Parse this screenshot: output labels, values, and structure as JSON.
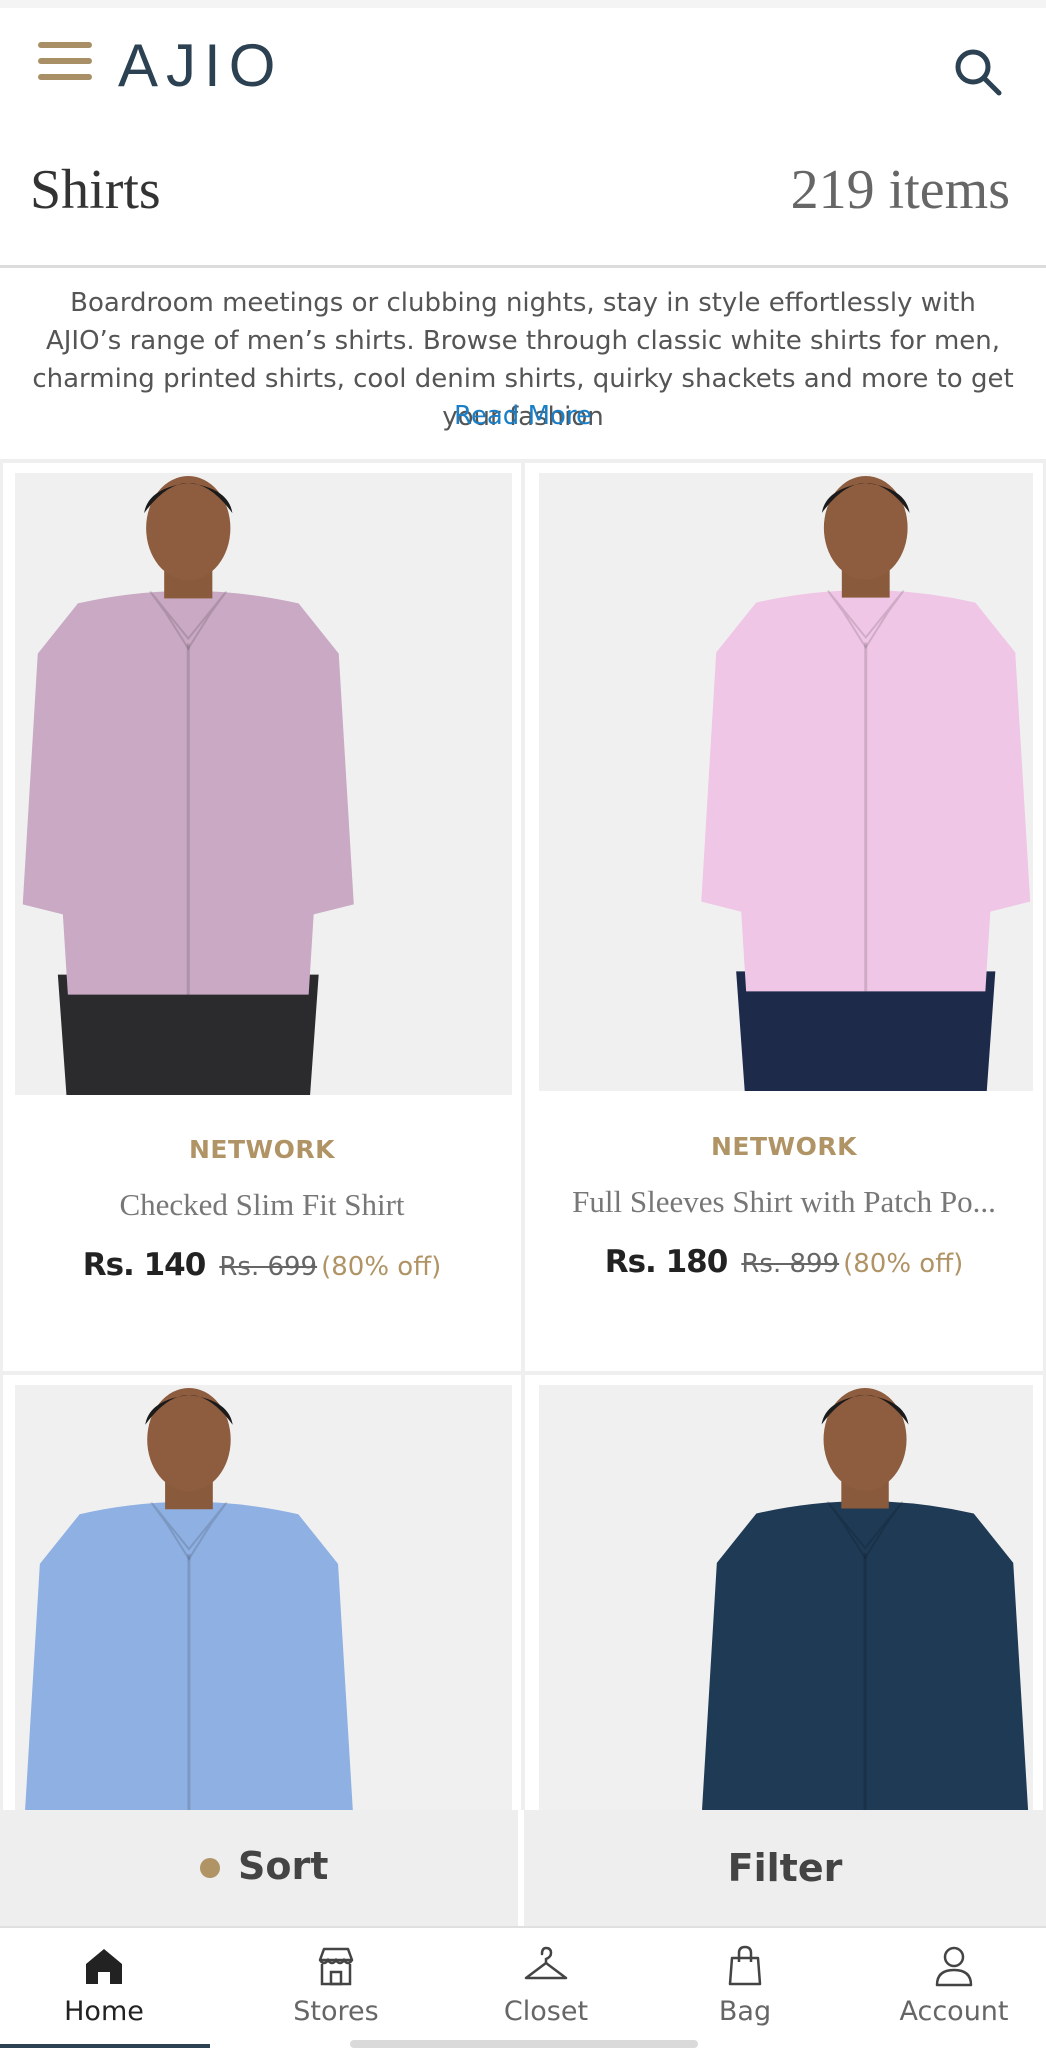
{
  "header": {
    "logo": "AJIO"
  },
  "title_row": {
    "title": "Shirts",
    "count": "219 items"
  },
  "description": {
    "text": "Boardroom meetings or clubbing nights, stay in style effortlessly with AJIO’s range of men’s shirts. Browse through classic white shirts for men, charming printed shirts, cool denim shirts, quirky shackets and more to get your fashion",
    "read_more": "Read More"
  },
  "products": [
    {
      "brand": "NETWORK",
      "name": "Checked Slim Fit Shirt",
      "price": "Rs. 140",
      "mrp": "Rs. 699",
      "discount": "(80% off)",
      "shirt_color": "#c9a9c4",
      "pants_color": "#2b2b2e"
    },
    {
      "brand": "NETWORK",
      "name": "Full Sleeves Shirt with Patch Po...",
      "price": "Rs. 180",
      "mrp": "Rs. 899",
      "discount": "(80% off)",
      "shirt_color": "#efc6e6",
      "pants_color": "#1e2a4a"
    },
    {
      "shirt_color": "#8fb0e2",
      "pants_color": "#2b2b2e"
    },
    {
      "shirt_color": "#1f3a55",
      "pants_color": "#1f3a55"
    }
  ],
  "actions": {
    "sort": "Sort",
    "filter": "Filter"
  },
  "nav": [
    {
      "label": "Home",
      "icon": "home-icon",
      "active": true
    },
    {
      "label": "Stores",
      "icon": "store-icon",
      "active": false
    },
    {
      "label": "Closet",
      "icon": "hanger-icon",
      "active": false
    },
    {
      "label": "Bag",
      "icon": "bag-icon",
      "active": false
    },
    {
      "label": "Account",
      "icon": "account-icon",
      "active": false
    }
  ],
  "colors": {
    "brand_gold": "#b09466",
    "logo_navy": "#2c4152",
    "link_blue": "#1a7fc6"
  }
}
